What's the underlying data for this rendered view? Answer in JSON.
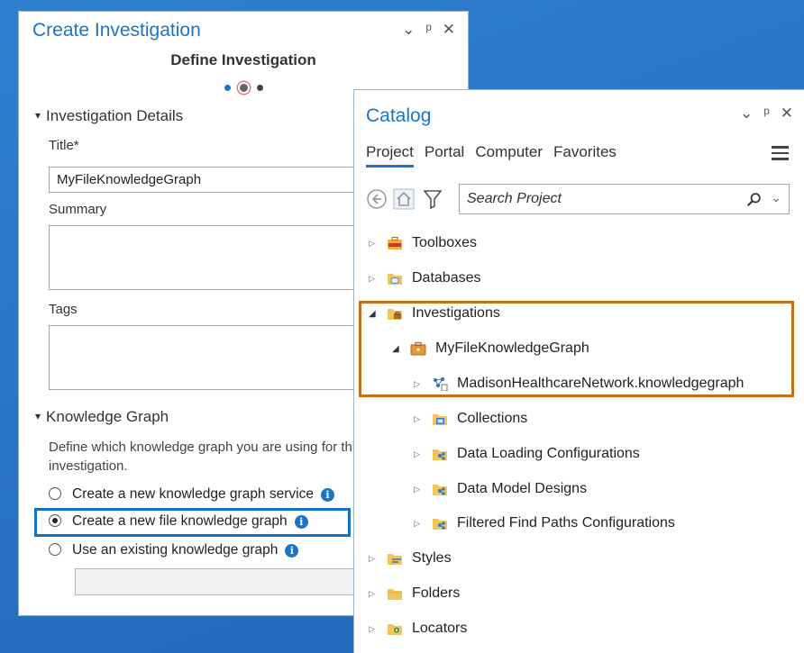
{
  "create_investigation": {
    "title": "Create Investigation",
    "window_controls": [
      "⌄",
      "ᵖ",
      "✕"
    ],
    "subtitle": "Define Investigation",
    "step_count": 3,
    "current_step": 2,
    "details_section": {
      "heading": "Investigation Details",
      "title_label": "Title*",
      "title_value": "MyFileKnowledgeGraph",
      "summary_label": "Summary",
      "tags_label": "Tags"
    },
    "kg_section": {
      "heading": "Knowledge Graph",
      "description": "Define which knowledge graph you are using for this investigation.",
      "options": [
        {
          "label": "Create a new knowledge graph service",
          "selected": false
        },
        {
          "label": "Create a new file knowledge graph",
          "selected": true
        },
        {
          "label": "Use an existing knowledge graph",
          "selected": false
        }
      ]
    }
  },
  "catalog": {
    "title": "Catalog",
    "tabs": [
      "Project",
      "Portal",
      "Computer",
      "Favorites"
    ],
    "active_tab": "Project",
    "search_placeholder": "Search Project",
    "tree": [
      {
        "label": "Toolboxes",
        "icon": "toolbox-icon",
        "level": 0,
        "expanded": false
      },
      {
        "label": "Databases",
        "icon": "database-icon",
        "level": 0,
        "expanded": false
      },
      {
        "label": "Investigations",
        "icon": "investigations-folder-icon",
        "level": 0,
        "expanded": true
      },
      {
        "label": "MyFileKnowledgeGraph",
        "icon": "investigation-briefcase-icon",
        "level": 1,
        "expanded": true
      },
      {
        "label": "MadisonHealthcareNetwork.knowledgegraph",
        "icon": "knowledge-graph-icon",
        "level": 2,
        "expanded": false
      },
      {
        "label": "Collections",
        "icon": "collections-icon",
        "level": 2,
        "expanded": false
      },
      {
        "label": "Data Loading Configurations",
        "icon": "config-folder-icon",
        "level": 2,
        "expanded": false
      },
      {
        "label": "Data Model Designs",
        "icon": "config-folder-icon",
        "level": 2,
        "expanded": false
      },
      {
        "label": "Filtered Find Paths Configurations",
        "icon": "config-folder-icon",
        "level": 2,
        "expanded": false
      },
      {
        "label": "Styles",
        "icon": "styles-icon",
        "level": 0,
        "expanded": false
      },
      {
        "label": "Folders",
        "icon": "folder-icon",
        "level": 0,
        "expanded": false
      },
      {
        "label": "Locators",
        "icon": "locators-icon",
        "level": 0,
        "expanded": false
      }
    ]
  },
  "colors": {
    "accent": "#1d74c6",
    "highlight_blue": "#1274c8",
    "highlight_orange": "#c86f16",
    "background": "#2a74c4"
  }
}
